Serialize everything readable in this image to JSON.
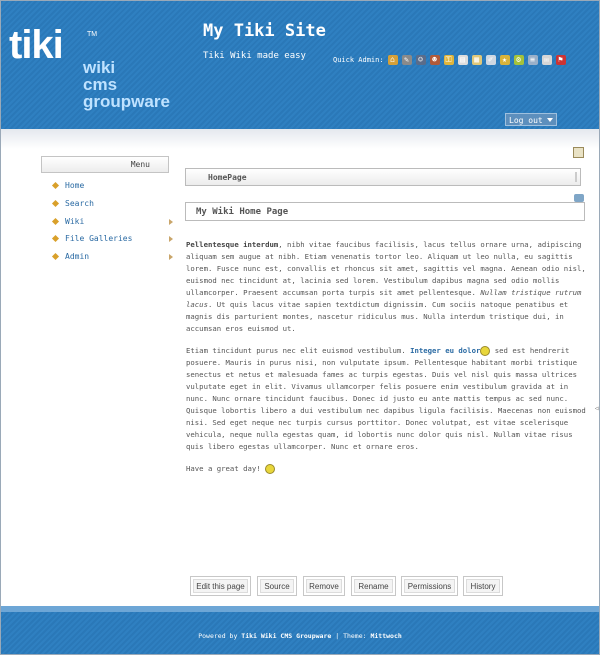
{
  "header": {
    "logo": {
      "word": "tiki",
      "tm": "TM",
      "lines": [
        "wiki",
        "cms",
        "groupware"
      ]
    },
    "site_title": "My Tiki Site",
    "slogan": "Tiki Wiki made easy",
    "quick_admin_label": "Quick Admin:",
    "quick_admin_icons": [
      {
        "name": "home-icon",
        "color": "#d5a038",
        "glyph": "⌂"
      },
      {
        "name": "wrench-icon",
        "color": "#8a8a8a",
        "glyph": "✎"
      },
      {
        "name": "users-icon",
        "color": "#5a6c8a",
        "glyph": "☺"
      },
      {
        "name": "groups-icon",
        "color": "#b05a3a",
        "glyph": "☻"
      },
      {
        "name": "key-icon",
        "color": "#e0b53a",
        "glyph": "⚿"
      },
      {
        "name": "modules-icon",
        "color": "#dddddd",
        "glyph": "▤"
      },
      {
        "name": "tracker-icon",
        "color": "#e0c87a",
        "glyph": "▦"
      },
      {
        "name": "edit-icon",
        "color": "#cfd8e2",
        "glyph": "✐"
      },
      {
        "name": "star-icon",
        "color": "#d9b33a",
        "glyph": "★"
      },
      {
        "name": "gear-icon",
        "color": "#a5c23a",
        "glyph": "⚙"
      },
      {
        "name": "list-icon",
        "color": "#9ab0c9",
        "glyph": "≡"
      },
      {
        "name": "mail-icon",
        "color": "#d6d6d6",
        "glyph": "✉"
      },
      {
        "name": "flag-icon",
        "color": "#cc3333",
        "glyph": "⚑"
      }
    ],
    "logout_label": "Log out"
  },
  "sidebar": {
    "title": "Menu",
    "items": [
      {
        "label": "Home",
        "has_submenu": false
      },
      {
        "label": "Search",
        "has_submenu": false
      },
      {
        "label": "Wiki",
        "has_submenu": true
      },
      {
        "label": "File Galleries",
        "has_submenu": true
      },
      {
        "label": "Admin",
        "has_submenu": true
      }
    ]
  },
  "main": {
    "page_tab": "HomePage",
    "page_heading": "My Wiki Home Page",
    "paragraph1_bold": "Pellentesque interdum",
    "paragraph1": ", nibh vitae faucibus facilisis, lacus tellus ornare urna, adipiscing aliquam sem augue at nibh. Etiam venenatis tortor leo. Aliquam ut leo nulla, eu sagittis lorem. Fusce nunc est, convallis et rhoncus sit amet, sagittis vel magna. Aenean odio nisl, euismod nec tincidunt at, lacinia sed lorem. Vestibulum dapibus magna sed odio mollis ullamcorper. Praesent accumsan porta turpis sit amet pellentesque. ",
    "paragraph1_italic": "Nullam tristique rutrum lacus",
    "paragraph1_end": ". Ut quis lacus vitae sapien textdictum dignissim. Cum sociis natoque penatibus et magnis dis parturient montes, nascetur ridiculus mus. Nulla interdum tristique dui, in accumsan eros euismod ut.",
    "paragraph2_start": "Etiam tincidunt purus nec elit euismod vestibulum. ",
    "paragraph2_link": "Integer eu dolor",
    "paragraph2_end": " sed est hendrerit posuere. Mauris in purus nisi, non vulputate ipsum. Pellentesque habitant morbi tristique senectus et netus et malesuada fames ac turpis egestas. Duis vel nisl quis massa ultrices vulputate eget in elit. Vivamus ullamcorper felis posuere enim vestibulum gravida at in nunc. Nunc ornare tincidunt faucibus. Donec id justo eu ante mattis tempus ac sed nunc. Quisque lobortis libero a dui vestibulum nec dapibus ligula facilisis. Maecenas non euismod nisi. Sed eget neque nec turpis cursus porttitor. Donec volutpat, est vitae scelerisque vehicula, neque nulla egestas quam, id lobortis nunc dolor quis nisl. Nullam vitae risus quis libero egestas ullamcorper. Nunc et ornare eros.",
    "closing": "Have a great day!"
  },
  "actions": [
    {
      "label": "Edit this page",
      "name": "edit-this-page-button"
    },
    {
      "label": "Source",
      "name": "source-button"
    },
    {
      "label": "Remove",
      "name": "remove-button"
    },
    {
      "label": "Rename",
      "name": "rename-button"
    },
    {
      "label": "Permissions",
      "name": "permissions-button"
    },
    {
      "label": "History",
      "name": "history-button"
    }
  ],
  "footer": {
    "powered_by": "Powered by",
    "tiki_link": "Tiki Wiki CMS Groupware",
    "separator": "|",
    "theme_label": "Theme:",
    "theme_name": "Mittwoch"
  }
}
